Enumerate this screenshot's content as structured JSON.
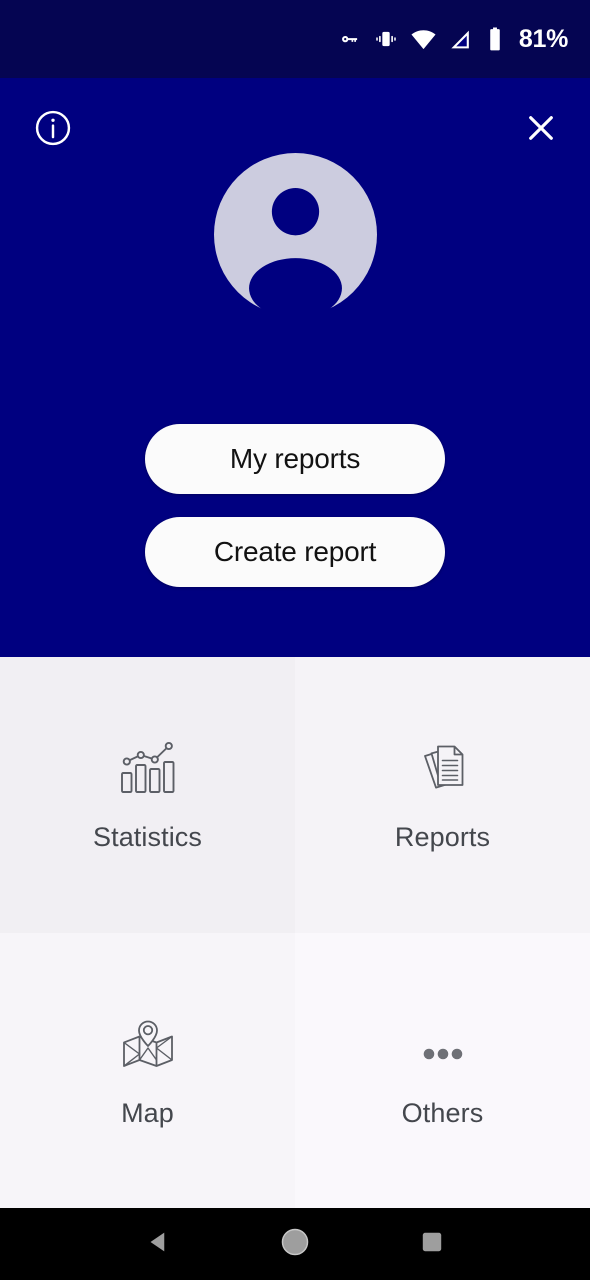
{
  "status_bar": {
    "icons": [
      "vpn-key-icon",
      "vibrate-icon",
      "wifi-icon",
      "cellular-signal-icon",
      "battery-icon"
    ],
    "battery_percent": "81%",
    "background_color": "#050552"
  },
  "hero": {
    "background_color": "#000080",
    "info_icon": "info-circle-icon",
    "close_icon": "close-icon",
    "avatar": {
      "icon": "user-avatar-icon",
      "circle_color": "#ccccdf",
      "silhouette_color": "#000080"
    },
    "buttons": [
      {
        "label": "My reports",
        "name": "my-reports-button"
      },
      {
        "label": "Create report",
        "name": "create-report-button"
      }
    ]
  },
  "grid": {
    "tiles": [
      {
        "label": "Statistics",
        "icon": "bar-chart-icon",
        "name": "tile-statistics",
        "background": "#f1eff3"
      },
      {
        "label": "Reports",
        "icon": "documents-icon",
        "name": "tile-reports",
        "background": "#f5f3f7"
      },
      {
        "label": "Map",
        "icon": "map-pin-icon",
        "name": "tile-map",
        "background": "#f7f5f9"
      },
      {
        "label": "Others",
        "icon": "more-dots-icon",
        "name": "tile-others",
        "background": "#faf8fc"
      }
    ],
    "icon_color": "#5c5f66",
    "label_color": "#44474d"
  },
  "nav_bar": {
    "background_color": "#000000",
    "buttons": [
      {
        "name": "nav-back-button",
        "icon": "triangle-back-icon"
      },
      {
        "name": "nav-home-button",
        "icon": "circle-home-icon"
      },
      {
        "name": "nav-recents-button",
        "icon": "square-recents-icon"
      }
    ],
    "icon_color": "#9e9e9e"
  }
}
